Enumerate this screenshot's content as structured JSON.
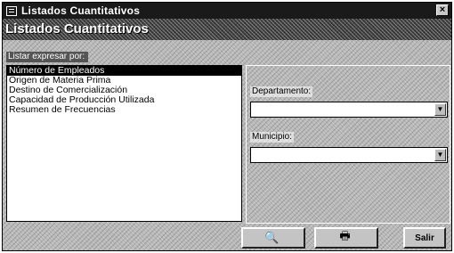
{
  "window": {
    "title": "Listados Cuantitativos",
    "close_label": "×"
  },
  "header": {
    "heading": "Listados Cuantitativos"
  },
  "list": {
    "label": "Listar expresar por:",
    "items": [
      "Número de Empleados",
      "Origen de Materia Prima",
      "Destino de Comercialización",
      "Capacidad de Producción Utilizada",
      "Resumen de Frecuencias"
    ],
    "selected_index": 0
  },
  "filters": {
    "departamento_label": "Departamento:",
    "departamento_value": "",
    "municipio_label": "Municipio:",
    "municipio_value": ""
  },
  "buttons": {
    "preview_icon": "preview-icon",
    "print_icon": "printer-icon",
    "exit_label": "Salir"
  }
}
